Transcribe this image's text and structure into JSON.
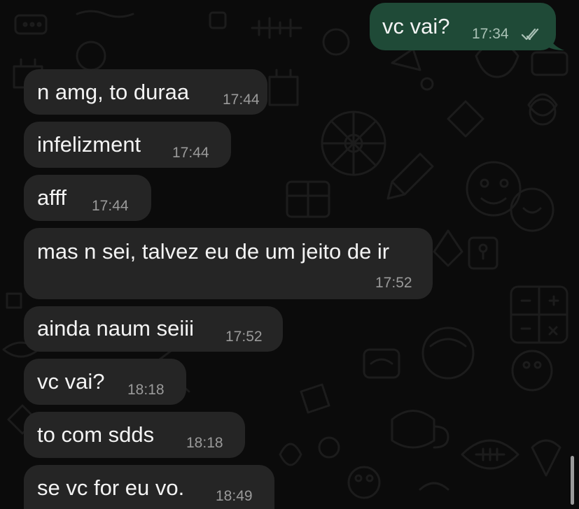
{
  "messages": [
    {
      "direction": "out",
      "text": "vc vai?",
      "time": "17:34",
      "status": "read"
    },
    {
      "direction": "in",
      "text": "n amg, to duraa",
      "time": "17:44"
    },
    {
      "direction": "in",
      "text": "infelizment",
      "time": "17:44"
    },
    {
      "direction": "in",
      "text": "afff",
      "time": "17:44"
    },
    {
      "direction": "in",
      "text": "mas n sei, talvez eu de um jeito de ir",
      "time": "17:52"
    },
    {
      "direction": "in",
      "text": "ainda naum seiii",
      "time": "17:52"
    },
    {
      "direction": "in",
      "text": "vc vai?",
      "time": "18:18"
    },
    {
      "direction": "in",
      "text": "to com sdds",
      "time": "18:18"
    },
    {
      "direction": "in",
      "text": "se vc for eu vo.",
      "time": "18:49"
    }
  ],
  "colors": {
    "background": "#0b0b0b",
    "incoming_bubble": "#252525",
    "outgoing_bubble": "#1f4a37",
    "read_ticks": "#a9c1b5"
  },
  "icons": [
    "double-check-read-icon",
    "doodle-wallpaper"
  ]
}
